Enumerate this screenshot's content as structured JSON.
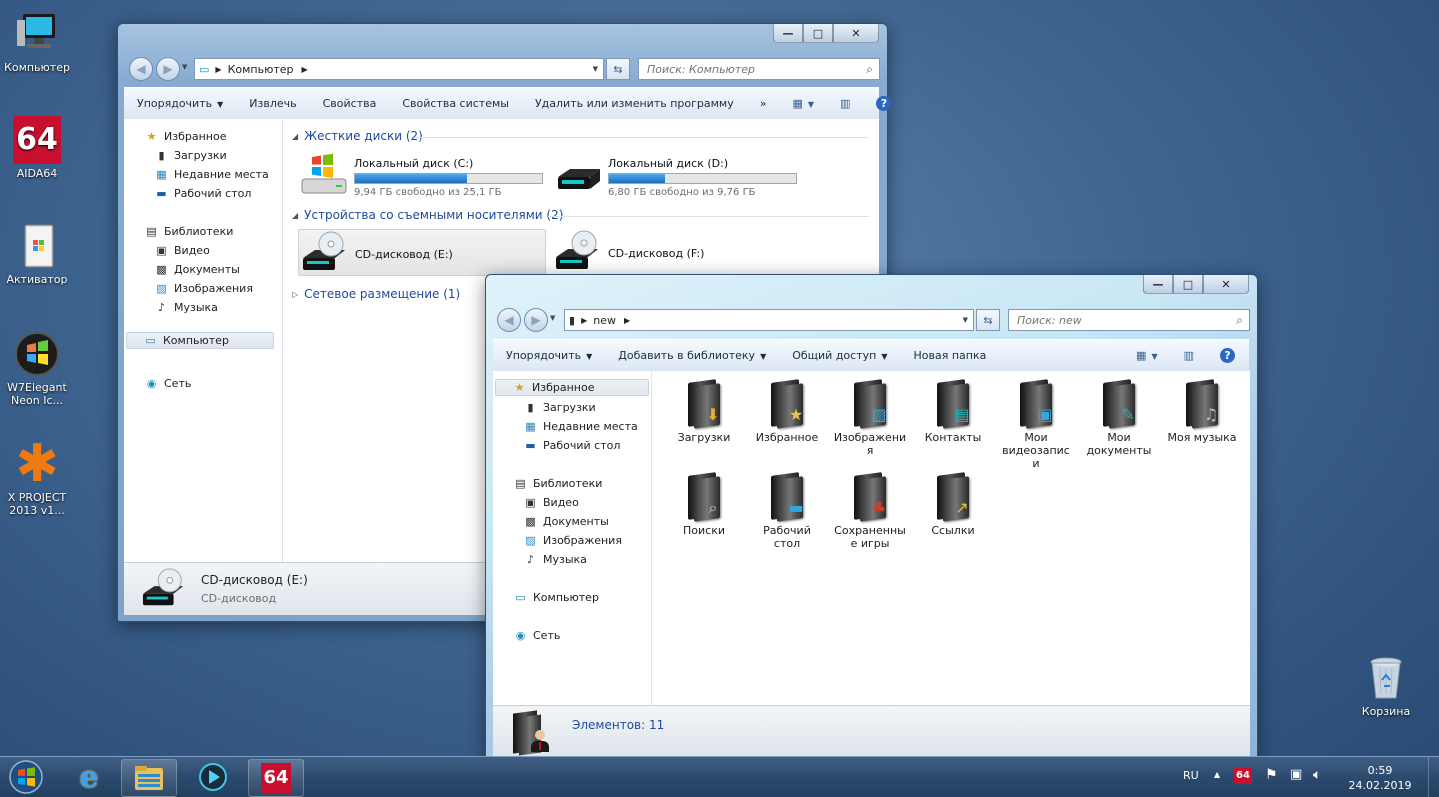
{
  "desktop": {
    "icons": [
      {
        "label": "Компьютер"
      },
      {
        "label": "AIDA64",
        "badge": "64"
      },
      {
        "label": "Активатор"
      },
      {
        "label_line1": "W7Elegant",
        "label_line2": "Neon Ic..."
      },
      {
        "label_line1": "X PROJECT",
        "label_line2": "2013 v1..."
      },
      {
        "label": "Корзина"
      }
    ]
  },
  "window1": {
    "address": {
      "crumb": "Компьютер"
    },
    "search": {
      "placeholder": "Поиск: Компьютер"
    },
    "toolbar": {
      "organize": "Упорядочить",
      "eject": "Извлечь",
      "properties": "Свойства",
      "system_properties": "Свойства системы",
      "uninstall": "Удалить или изменить программу",
      "more": "»"
    },
    "nav": {
      "favorites": "Избранное",
      "downloads": "Загрузки",
      "recent": "Недавние места",
      "desktop": "Рабочий стол",
      "libraries": "Библиотеки",
      "video": "Видео",
      "documents": "Документы",
      "pictures": "Изображения",
      "music": "Музыка",
      "computer": "Компьютер",
      "network": "Сеть"
    },
    "groups": {
      "hdd": "Жесткие диски (2)",
      "removable": "Устройства со съемными носителями (2)",
      "network": "Сетевое размещение (1)"
    },
    "drives": [
      {
        "name": "Локальный диск (C:)",
        "free": "9,94 ГБ свободно из 25,1 ГБ",
        "used_fraction": 0.6
      },
      {
        "name": "Локальный диск (D:)",
        "free": "6,80 ГБ свободно из 9,76 ГБ",
        "used_fraction": 0.3
      }
    ],
    "removable": [
      {
        "name": "CD-дисковод (E:)"
      },
      {
        "name": "CD-дисковод (F:)"
      }
    ],
    "details": {
      "title": "CD-дисковод (E:)",
      "subtitle": "CD-дисковод"
    }
  },
  "window2": {
    "address": {
      "crumb": "new"
    },
    "search": {
      "placeholder": "Поиск: new"
    },
    "toolbar": {
      "organize": "Упорядочить",
      "add_library": "Добавить в библиотеку",
      "share": "Общий доступ",
      "new_folder": "Новая папка"
    },
    "nav": {
      "favorites": "Избранное",
      "downloads": "Загрузки",
      "recent": "Недавние места",
      "desktop": "Рабочий стол",
      "libraries": "Библиотеки",
      "video": "Видео",
      "documents": "Документы",
      "pictures": "Изображения",
      "music": "Музыка",
      "computer": "Компьютер",
      "network": "Сеть"
    },
    "items": [
      {
        "line1": "Загрузки",
        "line2": "",
        "line3": "",
        "emblem": "download"
      },
      {
        "line1": "Избранное",
        "line2": "",
        "line3": "",
        "emblem": "star"
      },
      {
        "line1": "Изображени",
        "line2": "я",
        "line3": "",
        "emblem": "picture"
      },
      {
        "line1": "Контакты",
        "line2": "",
        "line3": "",
        "emblem": "contacts"
      },
      {
        "line1": "Мои",
        "line2": "видеозапис",
        "line3": "и",
        "emblem": "film"
      },
      {
        "line1": "Мои",
        "line2": "документы",
        "line3": "",
        "emblem": "document"
      },
      {
        "line1": "Моя музыка",
        "line2": "",
        "line3": "",
        "emblem": "music"
      },
      {
        "line1": "Поиски",
        "line2": "",
        "line3": "",
        "emblem": "magnifier"
      },
      {
        "line1": "Рабочий",
        "line2": "стол",
        "line3": "",
        "emblem": "desktop"
      },
      {
        "line1": "Сохраненны",
        "line2": "е игры",
        "line3": "",
        "emblem": "games"
      },
      {
        "line1": "Ссылки",
        "line2": "",
        "line3": "",
        "emblem": "link"
      }
    ],
    "details": {
      "count": "Элементов: 11"
    }
  },
  "taskbar": {
    "lang": "RU",
    "aida_badge": "64",
    "time": "0:59",
    "date": "24.02.2019"
  },
  "colors": {
    "accent_blue": "#1e4a9b",
    "disk_fill": "#2a82d6",
    "desktop_bg": "#3f6591"
  }
}
